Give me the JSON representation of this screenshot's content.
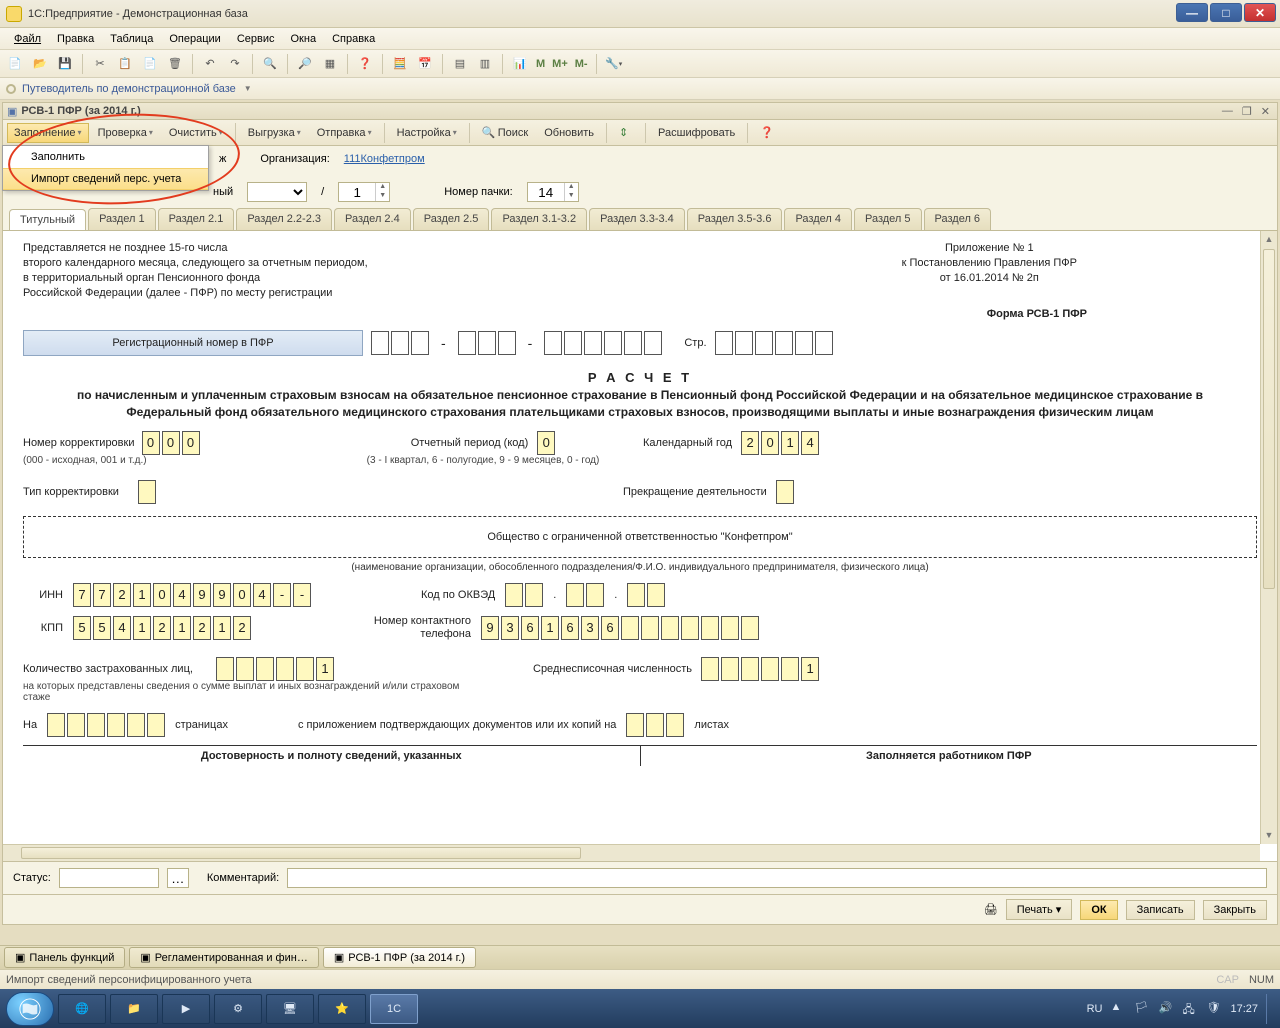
{
  "window_title": "1С:Предприятие - Демонстрационная база",
  "main_menu": [
    "Файл",
    "Правка",
    "Таблица",
    "Операции",
    "Сервис",
    "Окна",
    "Справка"
  ],
  "guide_label": "Путеводитель по демонстрационной базе",
  "m_labels": {
    "m": "M",
    "mp": "M+",
    "mm": "M-"
  },
  "doc": {
    "title": "РСВ-1 ПФР (за 2014 г.)",
    "toolbar": {
      "fill": "Заполнение",
      "check": "Проверка",
      "clear": "Очистить",
      "export": "Выгрузка",
      "send": "Отправка",
      "settings": "Настройка",
      "find": "Поиск",
      "refresh": "Обновить",
      "decrypt": "Расшифровать"
    },
    "dropdown": {
      "fill": "Заполнить",
      "import": "Импорт сведений перс. учета"
    },
    "org_label": "Организация:",
    "org_value": "111Конфетпром",
    "period_suffix": "ный",
    "slash": "/",
    "one": "1",
    "pack_label": "Номер пачки:",
    "pack_value": "14",
    "tabs": [
      "Титульный",
      "Раздел 1",
      "Раздел 2.1",
      "Раздел 2.2-2.3",
      "Раздел 2.4",
      "Раздел 2.5",
      "Раздел 3.1-3.2",
      "Раздел 3.3-3.4",
      "Раздел 3.5-3.6",
      "Раздел 4",
      "Раздел 5",
      "Раздел 6"
    ]
  },
  "form": {
    "intro1": "Представляется не позднее 15-го числа",
    "intro2": "второго календарного месяца, следующего за отчетным периодом,",
    "intro3": "в территориальный орган Пенсионного фонда",
    "intro4": "Российской Федерации (далее - ПФР) по месту регистрации",
    "app_no": "Приложение № 1",
    "decree": "к Постановлению Правления ПФР",
    "decree_date": "от 16.01.2014 № 2п",
    "form_name": "Форма РСВ-1 ПФР",
    "reg_label": "Регистрационный номер в ПФР",
    "str_label": "Стр.",
    "heading": "Р А С Ч Е Т",
    "subheading": "по начисленным и уплаченным страховым взносам на обязательное пенсионное страхование в Пенсионный фонд Российской Федерации и на обязательное медицинское страхование в Федеральный фонд обязательного медицинского страхования плательщиками страховых взносов, производящими выплаты и иные вознаграждения физическим лицам",
    "korr_label": "Номер корректировки",
    "korr": [
      "0",
      "0",
      "0"
    ],
    "korr_note": "(000 - исходная, 001 и т.д.)",
    "period_label": "Отчетный период (код)",
    "period": "0",
    "period_note": "(3 - I квартал, 6 - полугодие, 9 - 9 месяцев, 0 - год)",
    "year_label": "Календарный год",
    "year": [
      "2",
      "0",
      "1",
      "4"
    ],
    "korr_type": "Тип корректировки",
    "cease": "Прекращение деятельности",
    "org_full": "Общество с ограниченной ответственностью \"Конфетпром\"",
    "org_caption": "(наименование организации, обособленного подразделения/Ф.И.О. индивидуального предпринимателя, физического лица)",
    "inn_label": "ИНН",
    "inn": [
      "7",
      "7",
      "2",
      "1",
      "0",
      "4",
      "9",
      "9",
      "0",
      "4",
      "-",
      "-"
    ],
    "okved_label": "Код по ОКВЭД",
    "kpp_label": "КПП",
    "kpp": [
      "5",
      "5",
      "4",
      "1",
      "2",
      "1",
      "2",
      "1",
      "2"
    ],
    "phone_label": "Номер контактного телефона",
    "phone": [
      "9",
      "3",
      "6",
      "1",
      "6",
      "3",
      "6",
      "",
      "",
      "",
      "",
      "",
      "",
      ""
    ],
    "insured_label": "Количество застрахованных лиц,",
    "insured_val": "1",
    "insured_note": "на которых представлены сведения о сумме выплат и иных вознаграждений и/или страховом стаже",
    "avg_label": "Среднесписочная численность",
    "avg_val": "1",
    "na": "На",
    "pages": "страницах",
    "attach": "с приложением подтверждающих документов или их копий на",
    "sheets": "листах",
    "col1": "Достоверность и полноту сведений, указанных",
    "col2": "Заполняется работником ПФР"
  },
  "bottom": {
    "status_label": "Статус:",
    "comment_label": "Комментарий:"
  },
  "actions": {
    "print": "Печать",
    "ok": "ОК",
    "save": "Записать",
    "close": "Закрыть"
  },
  "app_tabs": {
    "panel": "Панель функций",
    "regl": "Регламентированная и фин…",
    "rsv": "РСВ-1 ПФР (за 2014 г.)"
  },
  "hint": "Импорт сведений персонифицированного учета",
  "status_right": {
    "cap": "CAP",
    "num": "NUM"
  },
  "systray": {
    "lang": "RU",
    "time": "17:27"
  }
}
